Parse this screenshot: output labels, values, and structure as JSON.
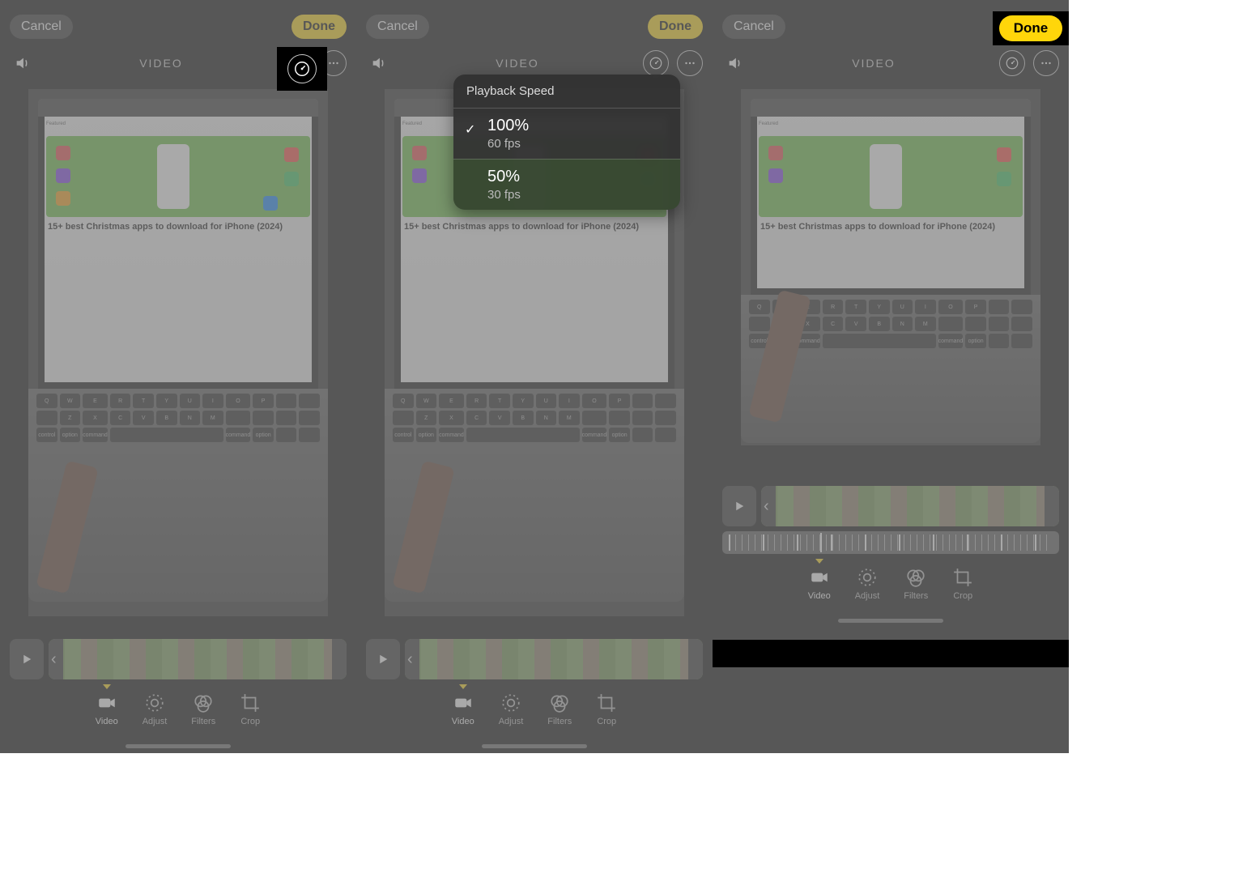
{
  "common": {
    "cancel_label": "Cancel",
    "done_label": "Done",
    "title": "VIDEO",
    "tools": {
      "video": "Video",
      "adjust": "Adjust",
      "filters": "Filters",
      "crop": "Crop"
    },
    "preview_headline": "15+ best Christmas apps to download for iPhone (2024)"
  },
  "popup": {
    "header": "Playback Speed",
    "options": [
      {
        "label": "100%",
        "sub": "60 fps",
        "selected": true
      },
      {
        "label": "50%",
        "sub": "30 fps",
        "selected": false
      }
    ]
  }
}
